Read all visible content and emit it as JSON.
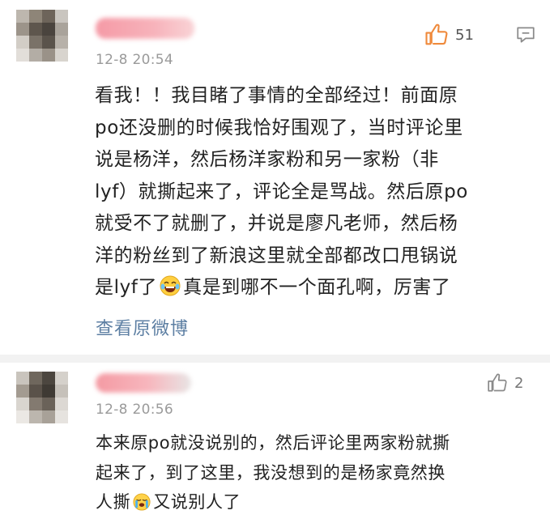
{
  "comments": [
    {
      "time": "12-8 20:54",
      "likes": "51",
      "lines": [
        "看我！！我目睹了事情的全部经过！前面原",
        "po还没删的时候我恰好围观了，当时评论里",
        "说是杨洋，然后杨洋家粉和另一家粉（非",
        "lyf）就撕起来了，评论全是骂战。然后原po",
        "就受不了就删了，并说是廖凡老师，然后杨",
        "洋的粉丝到了新浪这里就全部都改口甩锅说"
      ],
      "last_line_before": "是lyf了",
      "last_line_after": "真是到哪不一个面孔啊，厉害了",
      "view_original_label": "查看原微博"
    },
    {
      "time": "12-8 20:56",
      "likes": "2",
      "lines": [
        "本来原po就没说别的，然后评论里两家粉就撕",
        "起来了，到了这里，我没想到的是杨家竟然换"
      ],
      "last_line_before": "人撕",
      "last_line_after": "又说别人了"
    }
  ],
  "icons": {
    "like": "thumbs-up-icon",
    "reply": "comment-icon",
    "emoji_1": "laughing-tears-emoji",
    "emoji_2": "crying-emoji"
  },
  "colors": {
    "like_active": "#ef8a3c",
    "like_inactive": "#8a8a8a",
    "link": "#5d7fa3",
    "timestamp": "#9a9a9a",
    "name_blur": "#f7a8b0"
  }
}
